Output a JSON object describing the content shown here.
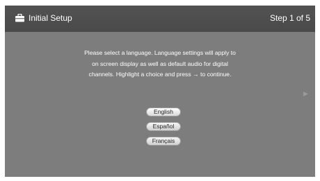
{
  "header": {
    "title": "Initial Setup",
    "step": "Step 1 of 5"
  },
  "instructions": {
    "line1": "Please select a language. Language settings will apply to",
    "line2": "on screen display as well as default audio for digital",
    "line3": "channels.  Highlight a choice and press → to continue."
  },
  "languages": [
    {
      "label": "English",
      "selected": true
    },
    {
      "label": "Español",
      "selected": false
    },
    {
      "label": "Français",
      "selected": false
    }
  ],
  "icons": {
    "header": "toolbox-icon",
    "next": "next-arrow-icon"
  },
  "colors": {
    "background": "#7d7d7d",
    "header": "#4d4d4d",
    "text": "#ffffff"
  }
}
